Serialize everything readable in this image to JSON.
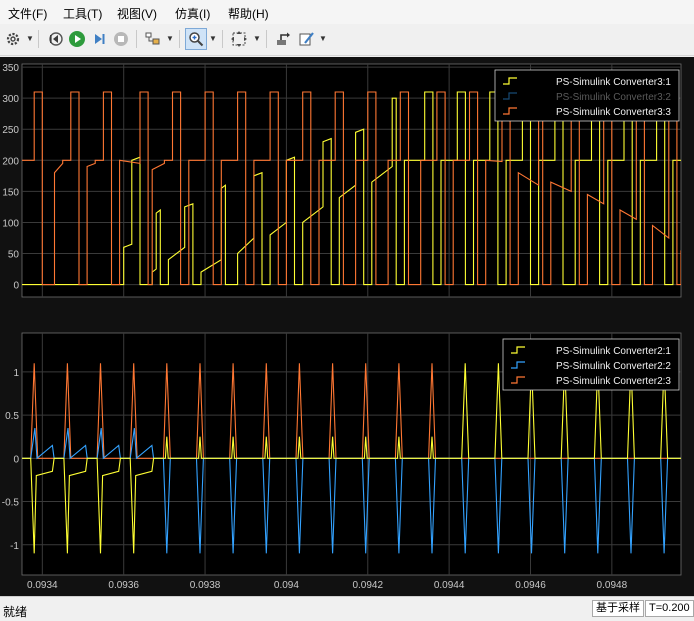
{
  "menu": [
    "文件(F)",
    "工具(T)",
    "视图(V)",
    "仿真(I)",
    "帮助(H)"
  ],
  "toolbar": {
    "icons": [
      "gear-icon",
      "rewind-icon",
      "run-icon",
      "step-forward-icon",
      "stop-icon",
      "style-icon",
      "zoom-icon",
      "autoscale-icon",
      "signal-select-icon",
      "edit-icon"
    ]
  },
  "colors": {
    "series1": "#ffff33",
    "series2": "#33a2ff",
    "series3": "#ff7733",
    "grid": "#3a3a3a",
    "axes_text": "#c8c8c8",
    "plot_bg": "#000000",
    "figure_bg": "#111111"
  },
  "chart_data": [
    {
      "type": "line",
      "title": "",
      "xlim": [
        0.09335,
        0.09497
      ],
      "ylim": [
        -20,
        355
      ],
      "yticks": [
        0,
        50,
        100,
        150,
        200,
        250,
        300,
        350
      ],
      "legend": "top-right",
      "series": [
        {
          "name": "PS-Simulink Converter3:1",
          "color": "#ffff33",
          "legend_dim": false,
          "points": [
            [
              0.09335,
              0
            ],
            [
              0.0936,
              0
            ],
            [
              0.0936,
              60
            ],
            [
              0.09362,
              65
            ],
            [
              0.09362,
              200
            ],
            [
              0.09364,
              205
            ],
            [
              0.09364,
              0
            ],
            [
              0.09367,
              0
            ],
            [
              0.09367,
              20
            ],
            [
              0.09368,
              25
            ],
            [
              0.09368,
              115
            ],
            [
              0.09369,
              120
            ],
            [
              0.09369,
              0
            ],
            [
              0.09371,
              0
            ],
            [
              0.09371,
              40
            ],
            [
              0.09375,
              60
            ],
            [
              0.09375,
              125
            ],
            [
              0.09377,
              130
            ],
            [
              0.09377,
              0
            ],
            [
              0.09379,
              0
            ],
            [
              0.09379,
              20
            ],
            [
              0.09384,
              40
            ],
            [
              0.09384,
              155
            ],
            [
              0.09385,
              160
            ],
            [
              0.09385,
              0
            ],
            [
              0.09388,
              0
            ],
            [
              0.09388,
              50
            ],
            [
              0.09392,
              75
            ],
            [
              0.09392,
              175
            ],
            [
              0.09394,
              180
            ],
            [
              0.09394,
              0
            ],
            [
              0.09396,
              0
            ],
            [
              0.09396,
              80
            ],
            [
              0.094,
              100
            ],
            [
              0.094,
              200
            ],
            [
              0.09402,
              205
            ],
            [
              0.09402,
              0
            ],
            [
              0.09404,
              0
            ],
            [
              0.09404,
              100
            ],
            [
              0.09409,
              125
            ],
            [
              0.09409,
              230
            ],
            [
              0.09411,
              235
            ],
            [
              0.09411,
              0
            ],
            [
              0.09413,
              0
            ],
            [
              0.09413,
              140
            ],
            [
              0.09417,
              160
            ],
            [
              0.09417,
              245
            ],
            [
              0.09419,
              250
            ],
            [
              0.09419,
              0
            ],
            [
              0.09421,
              0
            ],
            [
              0.09421,
              165
            ],
            [
              0.09426,
              190
            ],
            [
              0.09426,
              300
            ],
            [
              0.09427,
              300
            ],
            [
              0.09427,
              0
            ],
            [
              0.09429,
              0
            ],
            [
              0.09429,
              200
            ],
            [
              0.09434,
              200
            ],
            [
              0.09434,
              310
            ],
            [
              0.09436,
              310
            ],
            [
              0.09436,
              0
            ],
            [
              0.09438,
              0
            ],
            [
              0.09438,
              200
            ],
            [
              0.09442,
              200
            ],
            [
              0.09442,
              310
            ],
            [
              0.09444,
              310
            ],
            [
              0.09444,
              0
            ],
            [
              0.09446,
              0
            ],
            [
              0.09446,
              200
            ],
            [
              0.0945,
              200
            ],
            [
              0.0945,
              310
            ],
            [
              0.09452,
              310
            ],
            [
              0.09452,
              0
            ],
            [
              0.09454,
              0
            ],
            [
              0.09454,
              200
            ],
            [
              0.09458,
              200
            ],
            [
              0.09458,
              310
            ],
            [
              0.0946,
              310
            ],
            [
              0.0946,
              0
            ],
            [
              0.09462,
              0
            ],
            [
              0.09462,
              200
            ],
            [
              0.09466,
              200
            ],
            [
              0.09466,
              310
            ],
            [
              0.09468,
              310
            ],
            [
              0.09468,
              0
            ],
            [
              0.09471,
              0
            ],
            [
              0.09471,
              200
            ],
            [
              0.09475,
              200
            ],
            [
              0.09475,
              310
            ],
            [
              0.09477,
              310
            ],
            [
              0.09477,
              0
            ],
            [
              0.09479,
              0
            ],
            [
              0.09479,
              200
            ],
            [
              0.09483,
              200
            ],
            [
              0.09483,
              310
            ],
            [
              0.09485,
              310
            ],
            [
              0.09485,
              0
            ],
            [
              0.09487,
              0
            ],
            [
              0.09487,
              200
            ],
            [
              0.09491,
              200
            ],
            [
              0.09491,
              310
            ],
            [
              0.09493,
              310
            ],
            [
              0.09493,
              0
            ],
            [
              0.09495,
              0
            ],
            [
              0.09495,
              200
            ],
            [
              0.09497,
              200
            ]
          ]
        },
        {
          "name": "PS-Simulink Converter3:2",
          "color": "#33a2ff",
          "legend_dim": true,
          "points": []
        },
        {
          "name": "PS-Simulink Converter3:3",
          "color": "#ff7733",
          "legend_dim": false,
          "points": [
            [
              0.09335,
              200
            ],
            [
              0.09338,
              200
            ],
            [
              0.09338,
              310
            ],
            [
              0.0934,
              310
            ],
            [
              0.0934,
              0
            ],
            [
              0.09343,
              0
            ],
            [
              0.09343,
              180
            ],
            [
              0.09345,
              195
            ],
            [
              0.09345,
              200
            ],
            [
              0.09347,
              200
            ],
            [
              0.09347,
              310
            ],
            [
              0.09349,
              310
            ],
            [
              0.09349,
              0
            ],
            [
              0.09351,
              0
            ],
            [
              0.09351,
              190
            ],
            [
              0.09353,
              195
            ],
            [
              0.09353,
              200
            ],
            [
              0.09355,
              200
            ],
            [
              0.09355,
              310
            ],
            [
              0.09357,
              310
            ],
            [
              0.09357,
              0
            ],
            [
              0.09359,
              0
            ],
            [
              0.09359,
              200
            ],
            [
              0.09364,
              195
            ],
            [
              0.09364,
              310
            ],
            [
              0.09366,
              310
            ],
            [
              0.09366,
              0
            ],
            [
              0.09367,
              0
            ],
            [
              0.09367,
              185
            ],
            [
              0.0937,
              195
            ],
            [
              0.0937,
              200
            ],
            [
              0.09372,
              200
            ],
            [
              0.09372,
              310
            ],
            [
              0.09374,
              310
            ],
            [
              0.09374,
              0
            ],
            [
              0.09376,
              0
            ],
            [
              0.09376,
              200
            ],
            [
              0.0938,
              200
            ],
            [
              0.0938,
              310
            ],
            [
              0.09382,
              310
            ],
            [
              0.09382,
              0
            ],
            [
              0.09384,
              0
            ],
            [
              0.09384,
              200
            ],
            [
              0.09388,
              200
            ],
            [
              0.09388,
              310
            ],
            [
              0.0939,
              310
            ],
            [
              0.0939,
              0
            ],
            [
              0.09392,
              0
            ],
            [
              0.09392,
              200
            ],
            [
              0.09396,
              200
            ],
            [
              0.09396,
              310
            ],
            [
              0.09398,
              310
            ],
            [
              0.09398,
              0
            ],
            [
              0.094,
              0
            ],
            [
              0.094,
              200
            ],
            [
              0.09404,
              200
            ],
            [
              0.09404,
              310
            ],
            [
              0.09406,
              310
            ],
            [
              0.09406,
              0
            ],
            [
              0.09408,
              0
            ],
            [
              0.09408,
              200
            ],
            [
              0.09412,
              200
            ],
            [
              0.09412,
              310
            ],
            [
              0.09414,
              310
            ],
            [
              0.09414,
              0
            ],
            [
              0.09417,
              0
            ],
            [
              0.09417,
              200
            ],
            [
              0.0942,
              200
            ],
            [
              0.0942,
              310
            ],
            [
              0.09422,
              310
            ],
            [
              0.09422,
              0
            ],
            [
              0.09425,
              0
            ],
            [
              0.09425,
              200
            ],
            [
              0.09428,
              200
            ],
            [
              0.09428,
              310
            ],
            [
              0.0943,
              310
            ],
            [
              0.0943,
              0
            ],
            [
              0.09433,
              0
            ],
            [
              0.09433,
              200
            ],
            [
              0.09437,
              200
            ],
            [
              0.09437,
              310
            ],
            [
              0.09439,
              310
            ],
            [
              0.09439,
              0
            ],
            [
              0.09441,
              0
            ],
            [
              0.09441,
              200
            ],
            [
              0.09445,
              200
            ],
            [
              0.09445,
              310
            ],
            [
              0.09447,
              310
            ],
            [
              0.09447,
              0
            ],
            [
              0.09449,
              0
            ],
            [
              0.09449,
              200
            ],
            [
              0.09453,
              198
            ],
            [
              0.09453,
              310
            ],
            [
              0.09455,
              310
            ],
            [
              0.09455,
              0
            ],
            [
              0.09457,
              0
            ],
            [
              0.09457,
              180
            ],
            [
              0.09462,
              160
            ],
            [
              0.09462,
              310
            ],
            [
              0.09463,
              310
            ],
            [
              0.09463,
              0
            ],
            [
              0.09465,
              0
            ],
            [
              0.09465,
              165
            ],
            [
              0.0947,
              150
            ],
            [
              0.0947,
              310
            ],
            [
              0.09472,
              310
            ],
            [
              0.09472,
              0
            ],
            [
              0.09474,
              0
            ],
            [
              0.09474,
              145
            ],
            [
              0.09478,
              130
            ],
            [
              0.09478,
              310
            ],
            [
              0.0948,
              310
            ],
            [
              0.0948,
              0
            ],
            [
              0.09482,
              0
            ],
            [
              0.09482,
              120
            ],
            [
              0.09486,
              105
            ],
            [
              0.09486,
              310
            ],
            [
              0.09488,
              310
            ],
            [
              0.09488,
              0
            ],
            [
              0.0949,
              0
            ],
            [
              0.0949,
              95
            ],
            [
              0.09494,
              75
            ],
            [
              0.09494,
              310
            ],
            [
              0.09496,
              310
            ],
            [
              0.09496,
              0
            ],
            [
              0.09497,
              0
            ],
            [
              0.09497,
              55
            ]
          ]
        }
      ]
    },
    {
      "type": "line",
      "title": "",
      "xlim": [
        0.09335,
        0.09497
      ],
      "ylim": [
        -1.35,
        1.45
      ],
      "yticks": [
        -1,
        -0.5,
        0,
        0.5,
        1
      ],
      "xticks": [
        0.0934,
        0.0936,
        0.0938,
        0.094,
        0.0942,
        0.0944,
        0.0946,
        0.0948
      ],
      "xtick_labels": [
        "0.0934",
        "0.0936",
        "0.0938",
        "0.094",
        "0.0942",
        "0.0944",
        "0.0946",
        "0.0948"
      ],
      "legend": "top-right",
      "pulse_period": 8.15e-05,
      "pulse_first_peak": 0.09338,
      "pulse_halfwidth": 8.5e-06,
      "series": [
        {
          "name": "PS-Simulink Converter2:1",
          "color": "#ffff33",
          "description_values": {
            "negative_peaks_until": 0.0937,
            "negative_peak": -1.1,
            "positive_peaks_from": 0.0944,
            "positive_peak": 1.1
          }
        },
        {
          "name": "PS-Simulink Converter2:2",
          "color": "#33a2ff",
          "description_values": {
            "negative_peaks_from": 0.0937,
            "negative_peak": -1.1,
            "early_positive_peak": 0.45
          }
        },
        {
          "name": "PS-Simulink Converter2:3",
          "color": "#ff7733",
          "description_values": {
            "positive_peaks_until": 0.0944,
            "positive_peak": 1.1
          }
        }
      ]
    }
  ],
  "status": {
    "left": "就绪",
    "mode": "基于采样",
    "time": "T=0.200"
  }
}
